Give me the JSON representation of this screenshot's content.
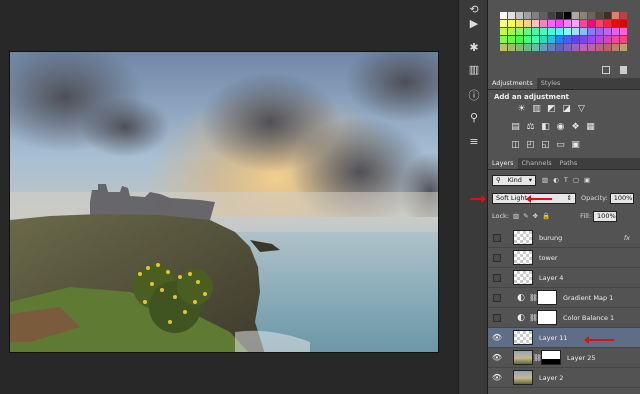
{
  "adjustments": {
    "tabs": [
      "Adjustments",
      "Styles"
    ],
    "title": "Add an adjustment"
  },
  "layers_panel": {
    "tabs": [
      "Layers",
      "Channels",
      "Paths"
    ],
    "filter_kind": "Kind",
    "blend_mode": "Soft Light",
    "opacity_label": "Opacity:",
    "opacity_value": "100%",
    "lock_label": "Lock:",
    "fill_label": "Fill:",
    "fill_value": "100%",
    "fx_label": "fx",
    "layers": [
      {
        "name": "burung",
        "visible": false,
        "fx": true,
        "selected": false
      },
      {
        "name": "tower",
        "visible": false,
        "fx": false,
        "selected": false
      },
      {
        "name": "Layer 4",
        "visible": false,
        "fx": false,
        "selected": false
      },
      {
        "name": "Gradient Map 1",
        "visible": false,
        "fx": false,
        "selected": false
      },
      {
        "name": "Color Balance 1",
        "visible": false,
        "fx": false,
        "selected": false
      },
      {
        "name": "Layer 11",
        "visible": true,
        "fx": false,
        "selected": true
      },
      {
        "name": "Layer 25",
        "visible": true,
        "fx": false,
        "selected": false
      },
      {
        "name": "Layer 2",
        "visible": true,
        "fx": false,
        "selected": false
      }
    ]
  },
  "colors": {
    "selected_layer": "#5e6e86",
    "annotation_arrow": "#e01010",
    "panel_bg": "#535353"
  }
}
